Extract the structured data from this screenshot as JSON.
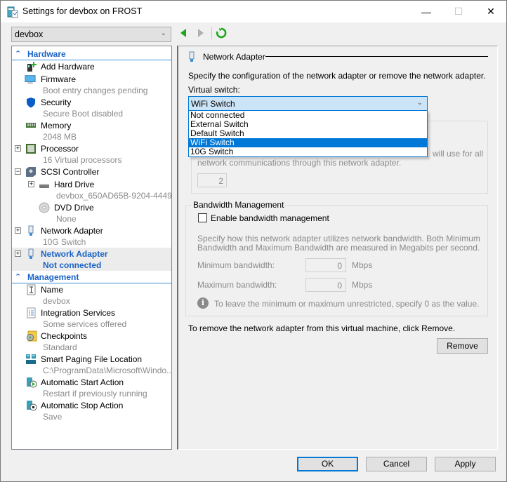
{
  "window": {
    "title": "Settings for devbox on FROST",
    "controls": {
      "minimize": "—",
      "maximize": "☐",
      "close": "✕"
    }
  },
  "toolbar": {
    "vm_selected": "devbox",
    "back_icon": "back-arrow-icon",
    "forward_icon": "forward-arrow-icon",
    "refresh_icon": "refresh-icon"
  },
  "tree": {
    "hardware_header": "Hardware",
    "management_header": "Management",
    "hardware_items": [
      {
        "name": "Add Hardware",
        "sub": "",
        "icon": "add-hardware-icon",
        "expander": ""
      },
      {
        "name": "Firmware",
        "sub": "Boot entry changes pending",
        "icon": "firmware-icon",
        "expander": ""
      },
      {
        "name": "Security",
        "sub": "Secure Boot disabled",
        "icon": "shield-icon",
        "expander": ""
      },
      {
        "name": "Memory",
        "sub": "2048 MB",
        "icon": "memory-icon",
        "expander": ""
      },
      {
        "name": "Processor",
        "sub": "16 Virtual processors",
        "icon": "processor-icon",
        "expander": "+"
      },
      {
        "name": "SCSI Controller",
        "sub": "",
        "icon": "scsi-controller-icon",
        "expander": "−"
      },
      {
        "name": "Hard Drive",
        "sub": "devbox_650AD65B-9204-4449...",
        "icon": "hard-drive-icon",
        "expander": "+"
      },
      {
        "name": "DVD Drive",
        "sub": "None",
        "icon": "dvd-drive-icon",
        "expander": ""
      },
      {
        "name": "Network Adapter",
        "sub": "10G Switch",
        "icon": "network-adapter-icon",
        "expander": "+"
      },
      {
        "name": "Network Adapter",
        "sub": "Not connected",
        "icon": "network-adapter-icon",
        "expander": "+",
        "selected": true
      }
    ],
    "management_items": [
      {
        "name": "Name",
        "sub": "devbox",
        "icon": "name-icon"
      },
      {
        "name": "Integration Services",
        "sub": "Some services offered",
        "icon": "integration-services-icon"
      },
      {
        "name": "Checkpoints",
        "sub": "Standard",
        "icon": "checkpoints-icon"
      },
      {
        "name": "Smart Paging File Location",
        "sub": "C:\\ProgramData\\Microsoft\\Windo...",
        "icon": "smart-paging-icon"
      },
      {
        "name": "Automatic Start Action",
        "sub": "Restart if previously running",
        "icon": "auto-start-icon"
      },
      {
        "name": "Automatic Stop Action",
        "sub": "Save",
        "icon": "auto-stop-icon"
      }
    ]
  },
  "panel": {
    "heading": "Network Adapter",
    "description": "Specify the configuration of the network adapter or remove the network adapter.",
    "virtual_switch_label": "Virtual switch:",
    "virtual_switch_value": "WiFi Switch",
    "virtual_switch_options": [
      "Not connected",
      "External Switch",
      "Default Switch",
      "WiFi Switch",
      "10G Switch"
    ],
    "virtual_switch_selected_index": 3,
    "vlan_text_line1": "will use for all",
    "vlan_text_line2": "network communications through this network adapter.",
    "vlan_value": "2",
    "bandwidth": {
      "title": "Bandwidth Management",
      "enable_label": "Enable bandwidth management",
      "enabled": false,
      "desc_line1": "Specify how this network adapter utilizes network bandwidth. Both Minimum",
      "desc_line2": "Bandwidth and Maximum Bandwidth are measured in Megabits per second.",
      "min_label": "Minimum bandwidth:",
      "min_value": "0",
      "max_label": "Maximum bandwidth:",
      "max_value": "0",
      "unit": "Mbps",
      "info_text": "To leave the minimum or maximum unrestricted, specify 0 as the value."
    },
    "remove_text": "To remove the network adapter from this virtual machine, click Remove.",
    "remove_button": "Remove"
  },
  "footer": {
    "ok": "OK",
    "cancel": "Cancel",
    "apply": "Apply"
  },
  "colors": {
    "accent": "#0078d7",
    "section_header": "#1a63c6",
    "disabled_text": "#8a8a8a",
    "nav_green": "#1ba81b"
  }
}
